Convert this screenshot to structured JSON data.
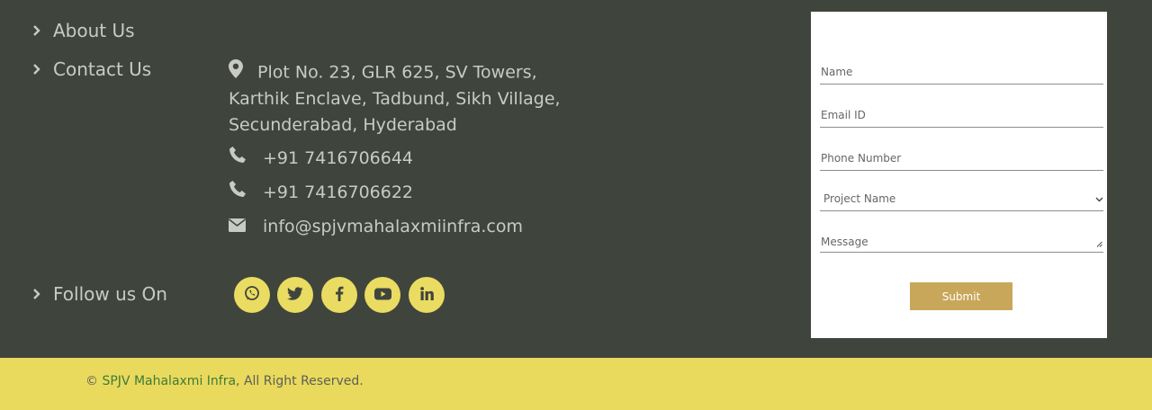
{
  "nav": {
    "about_label": "About Us",
    "contact_label": "Contact Us",
    "follow_label": "Follow us On"
  },
  "contact": {
    "address_line1": "Plot No. 23, GLR 625, SV Towers,",
    "address_line2": "Karthik Enclave, Tadbund, Sikh Village,",
    "address_line3": "Secunderabad, Hyderabad",
    "phone1": "+91 7416706644",
    "phone2": "+91 7416706622",
    "email": "info@spjvmahalaxmiinfra.com"
  },
  "social_icons": [
    "whatsapp-icon",
    "twitter-icon",
    "facebook-icon",
    "youtube-icon",
    "linkedin-icon"
  ],
  "form": {
    "name_placeholder": "Name",
    "email_placeholder": "Email ID",
    "phone_placeholder": "Phone Number",
    "project_selected": "Project Name",
    "message_placeholder": "Message",
    "submit_label": "Submit"
  },
  "footer_bottom": {
    "copyright_symbol": "©",
    "brand": "SPJV Mahalaxmi Infra",
    "rights": ", All Right Reserved."
  },
  "colors": {
    "background": "#3f453c",
    "accent_yellow": "#e9da5d",
    "button_gold": "#c9a75a",
    "brand_green": "#3f7a37",
    "text_light": "#c9cbc3"
  }
}
